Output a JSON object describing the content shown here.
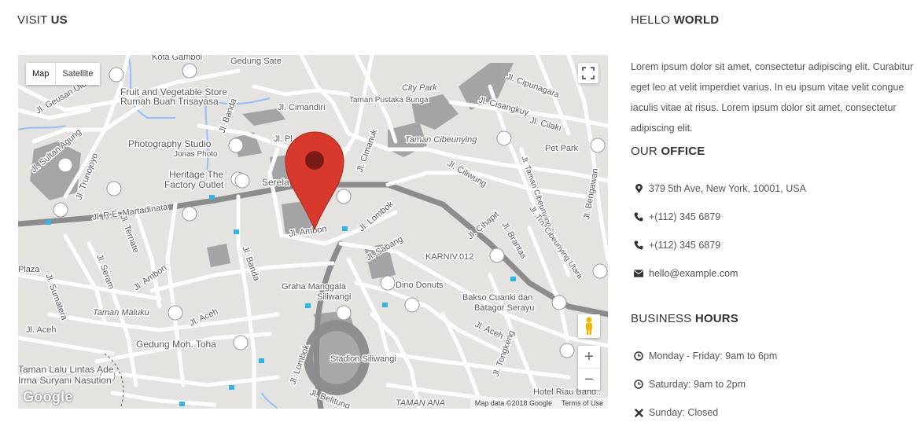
{
  "visit": {
    "light": "VISIT",
    "bold": "US"
  },
  "hello": {
    "light": "HELLO",
    "bold": "WORLD"
  },
  "intro": "Lorem ipsum dolor sit amet, consectetur adipiscing elit. Curabitur eget leo at velit imperdiet varius. In eu ipsum vitae velit congue iaculis vitae at risus. Lorem ipsum dolor sit amet, consectetur adipiscing elit.",
  "office": {
    "light": "OUR",
    "bold": "OFFICE",
    "address": "379 5th Ave, New York, 10001, USA",
    "phone1": "+(112) 345 6879",
    "phone2": "+(112) 345 6879",
    "email": "hello@example.com"
  },
  "hours": {
    "light": "BUSINESS",
    "bold": "HOURS",
    "weekdays": "Monday - Friday: 9am to 6pm",
    "saturday": "Saturday: 9am to 2pm",
    "sunday": "Sunday: Closed"
  },
  "map": {
    "map_label": "Map",
    "satellite_label": "Satellite",
    "logo": "Google",
    "attribution": "Map data ©2018 Google",
    "terms": "Terms of Use",
    "zoom_in": "+",
    "zoom_out": "−",
    "labels": {
      "kota": "Kota Gamboi",
      "gedung_sate": "Gedung Sate",
      "cipunagara": "Jl. Cipunagara",
      "geusan_ulun": "Jl. Geusan Ulun",
      "fruit_store": "Fruit and Vegetable Store",
      "rumah_buah": "Rumah Buah Trisayasa",
      "banda_top": "Jl. Banda",
      "cimandiri": "Jl. Cimandiri",
      "taman_pustaka": "Taman Pustaka Bunga",
      "city_park": "City Park",
      "cisangkuy": "Jl. Cisangkuy",
      "cilaki": "Jl. Cilaki",
      "sultan_agung": "Jl. Sultan Agung",
      "photo_studio": "Photography Studio",
      "jonas_photo": "Jonas Photo",
      "pl_label": "Jl. Pl...",
      "cimanuk": "Jl. Cimanuk",
      "taman_cibeunying": "Taman Cibeunying",
      "pet_park": "Pet Park",
      "trunojoyo": "Jl. Trunojoyo",
      "heritage": "Heritage The",
      "factory": "Factory Outlet",
      "serela": "Serela Bandung",
      "ciliwung": "Jl. Ciliwung",
      "taman_cibeunying_sel": "Jl. Taman Cibeunying Sel.",
      "bengawan": "Jl. Bengawan",
      "martadinata": "Jl. R.E. Martadinata",
      "lombok_top": "Jl. Lombok",
      "cihapit": "Jl. Cihapit",
      "tmn_cibeunying_utara": "Jl. Trn. Cibeunying Utara",
      "ternate": "Jl. Ternate",
      "ambon_top": "Jl. Ambon",
      "brantas": "Jl. Brantas",
      "sabang": "Jl. Sabang",
      "karniv": "KARNIV.012",
      "plaza": "Plaza",
      "seram": "Jl. Seram",
      "ambon_left": "Jl. Ambon",
      "banda_mid": "Jl. Banda",
      "dino_donuts": "Dino Donuts",
      "sumatera": "Jl. Sumatera",
      "graha": "Graha Manggala",
      "siliwangi": "Siliwangi",
      "bakso": "Bakso Cuanki dan",
      "batagor": "Batagor Serayu",
      "taman_maluku": "Taman Maluku",
      "aceh_mid": "Jl. Aceh",
      "aceh_right": "Jl. Aceh",
      "aceh_left": "Jl. Aceh",
      "gedung_moh": "Gedung Moh. Toha",
      "lombok_bottom": "Jl. Lombok",
      "stadion": "Stadion Siliwangi",
      "tongkeng": "Jl. Tongkeng",
      "lalu_lintas": "Taman Lalu Lintas Ade",
      "suryani": "Irma Suryani Nasution",
      "belitung": "Jl. Belitung",
      "taman_ana": "TAMAN ANA",
      "hotel_riau": "Hotel Riau Band..."
    }
  }
}
